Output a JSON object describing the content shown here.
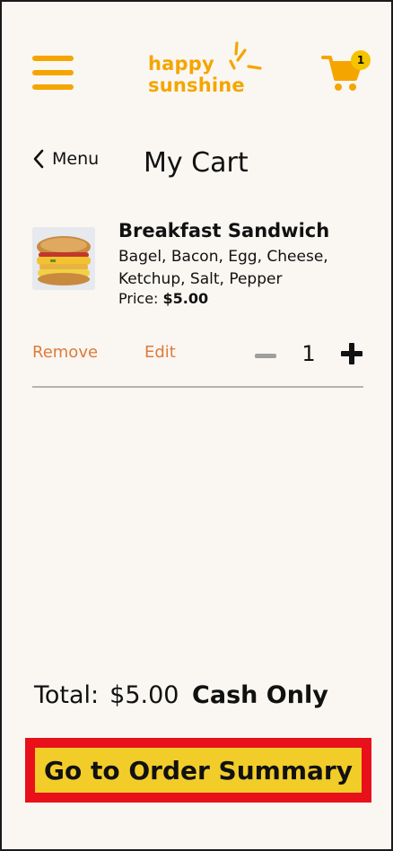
{
  "header": {
    "menu_icon": "hamburger-menu-icon",
    "logo": {
      "line1": "happy",
      "line2": "sunshine",
      "icon": "sun-rays-icon",
      "color": "#f5a500"
    },
    "cart": {
      "icon": "shopping-cart-icon",
      "badge_count": "1"
    }
  },
  "nav": {
    "back_label": "Menu",
    "back_icon": "chevron-left-icon"
  },
  "page": {
    "title": "My Cart"
  },
  "cart_items": [
    {
      "name": "Breakfast Sandwich",
      "description": "Bagel, Bacon, Egg, Cheese, Ketchup, Salt, Pepper",
      "price_label": "Price:",
      "price": "$5.00",
      "actions": {
        "remove": "Remove",
        "edit": "Edit"
      },
      "quantity": "1"
    }
  ],
  "summary": {
    "total_label": "Total:",
    "total_value": "$5.00",
    "payment_note": "Cash Only"
  },
  "cta": {
    "label": "Go to Order Summary"
  },
  "colors": {
    "accent": "#f5a500",
    "link": "#e07a3c",
    "cta_fill": "#f2cd2a",
    "cta_border": "#e8101a",
    "background": "#faf7f2"
  }
}
